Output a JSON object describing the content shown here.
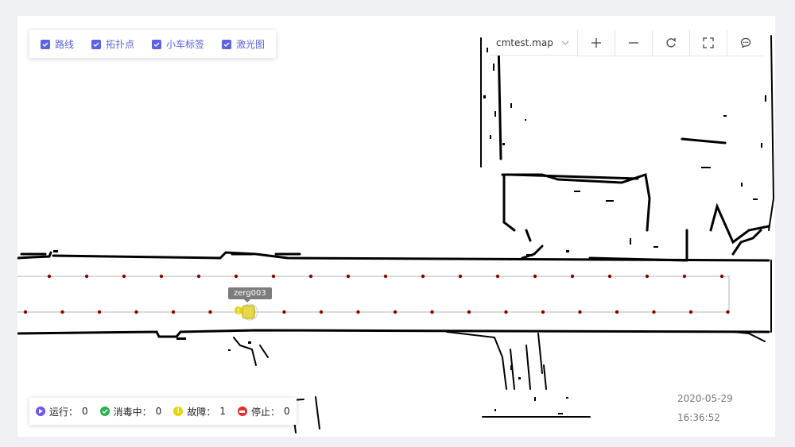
{
  "layers": [
    {
      "label": "路线",
      "checked": true
    },
    {
      "label": "拓扑点",
      "checked": true
    },
    {
      "label": "小车标签",
      "checked": true
    },
    {
      "label": "激光图",
      "checked": true
    }
  ],
  "toolbar": {
    "map_select": "cmtest.map",
    "buttons": [
      "zoom-in-icon",
      "zoom-out-icon",
      "refresh-icon",
      "fullscreen-icon",
      "message-icon"
    ]
  },
  "vehicle": {
    "label": "zerg003",
    "status": "fault"
  },
  "status_bar": {
    "running": {
      "label": "运行：",
      "count": "0",
      "color": "#6d55f0"
    },
    "disinfecting": {
      "label": "消毒中：",
      "count": "0",
      "color": "#2bb24c"
    },
    "fault": {
      "label": "故障：",
      "count": "1",
      "color": "#e8d400"
    },
    "stopped": {
      "label": "停止：",
      "count": "0",
      "color": "#e62b2b"
    }
  },
  "datetime": {
    "date": "2020-05-29",
    "time": "16:36:52"
  },
  "colors": {
    "accent": "#5b62e6",
    "topology_point": "#8b0000",
    "route": "#b5b5b5",
    "laser_map": "#000000"
  }
}
